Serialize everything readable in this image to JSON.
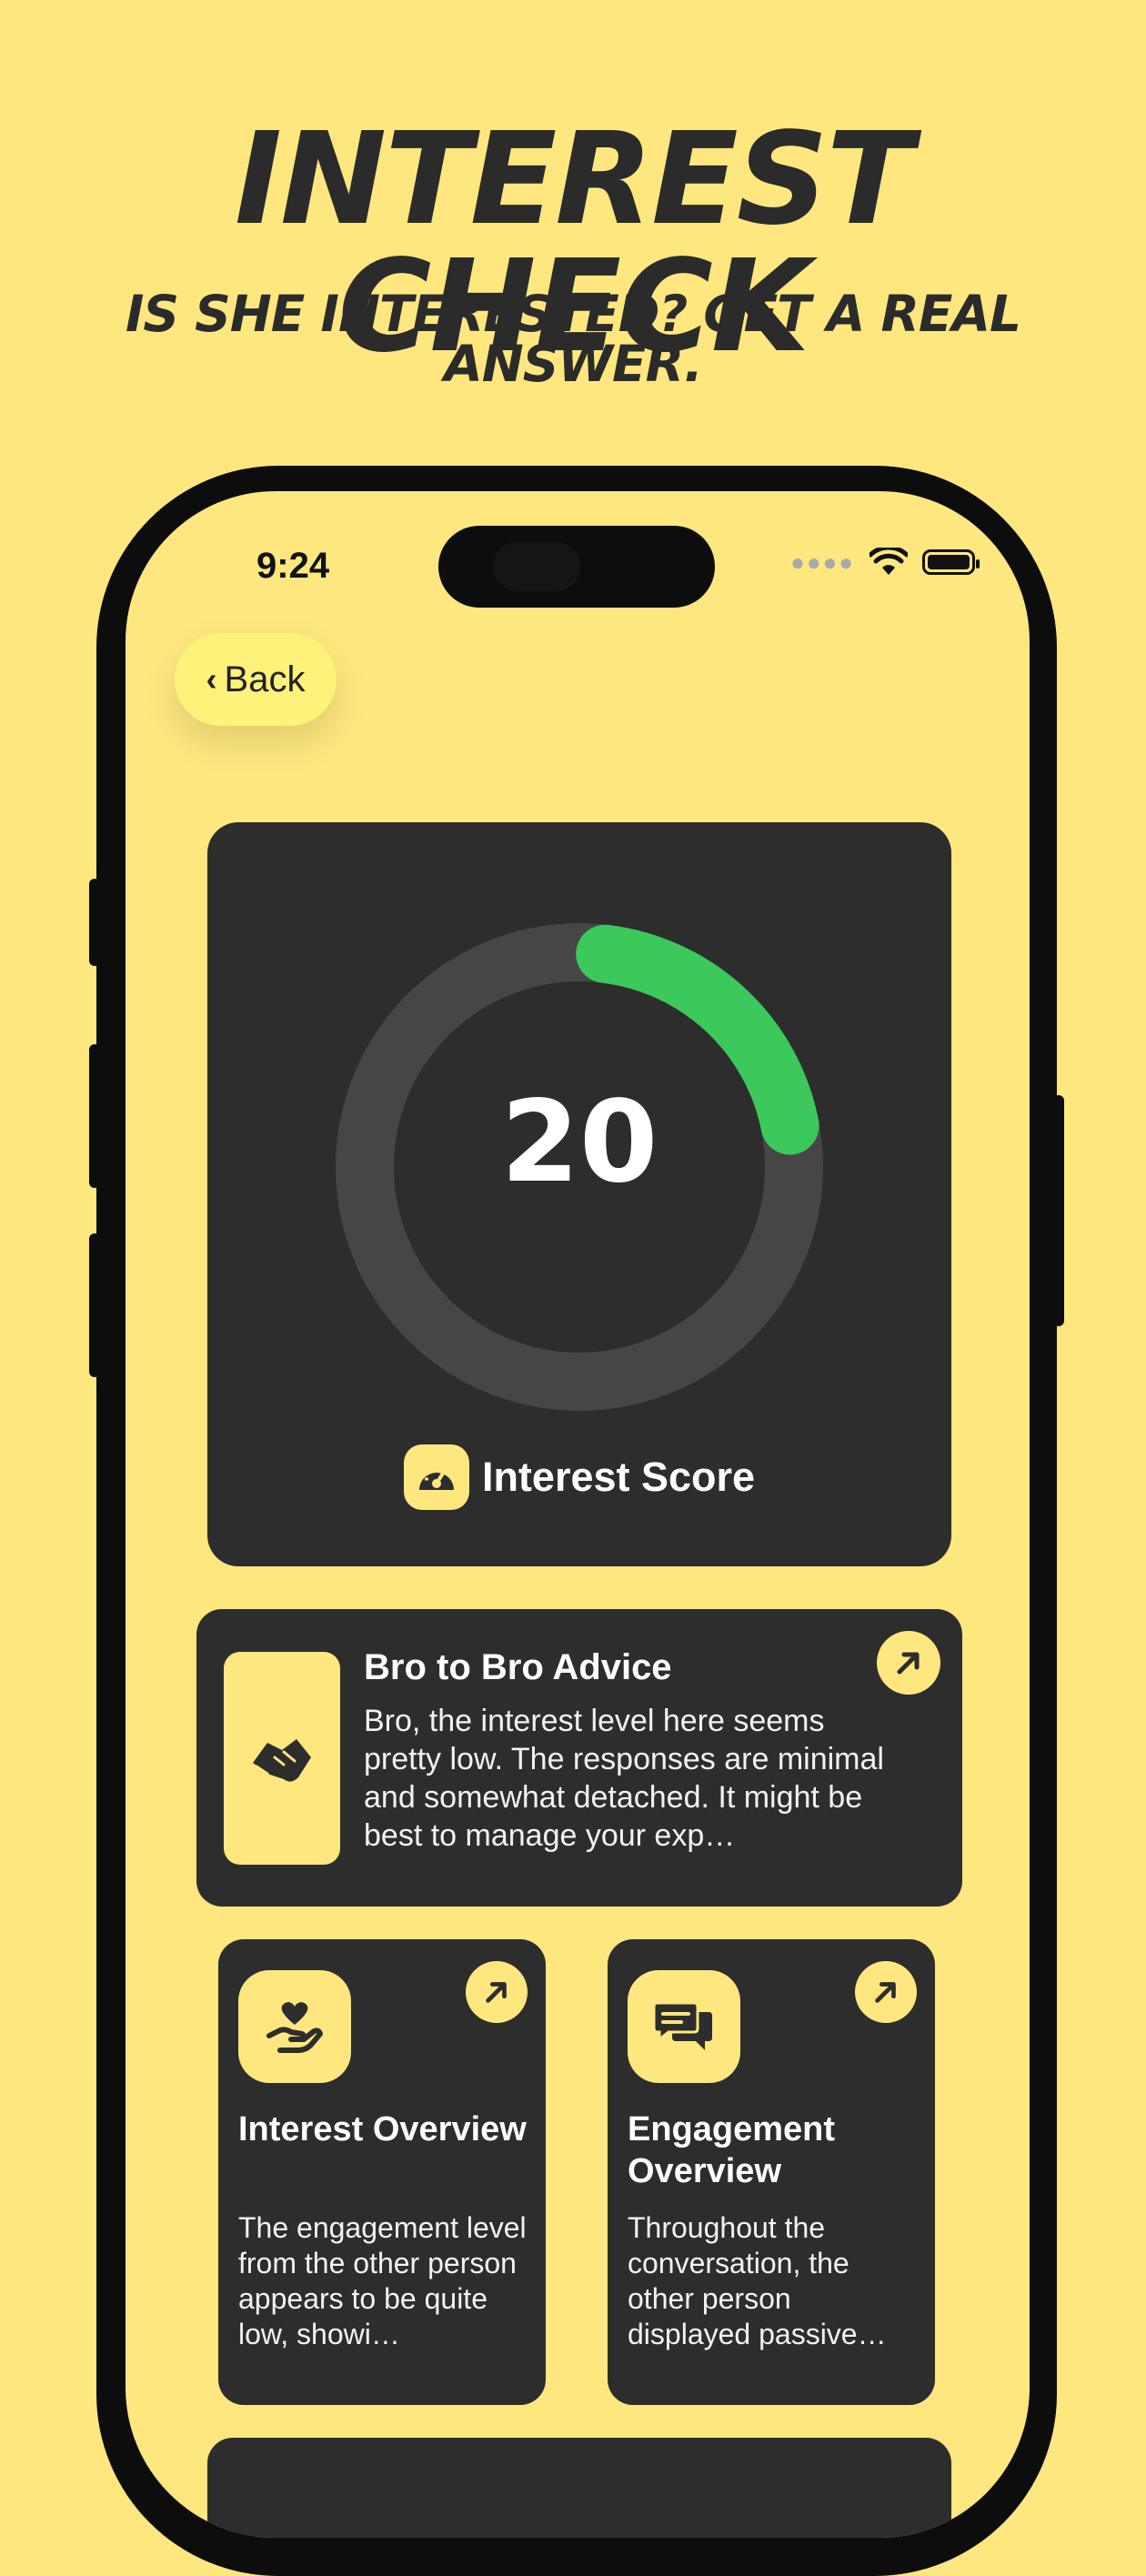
{
  "hero": {
    "title": "INTEREST CHECK",
    "subtitle": "IS SHE INTERESTED? GET A REAL ANSWER."
  },
  "status_bar": {
    "time": "9:24"
  },
  "nav": {
    "back_label": "Back"
  },
  "score": {
    "value": "20",
    "label": "Interest Score",
    "progress_fraction": 0.2,
    "accent_color": "#3CC85A",
    "track_color": "#464646"
  },
  "advice": {
    "title": "Bro to Bro Advice",
    "body": "Bro, the interest level here seems pretty low. The responses are minimal and somewhat detached. It might be best to manage your exp…",
    "icon": "handshake-icon"
  },
  "cards": [
    {
      "title": "Interest Overview",
      "body": "The engagement level from the other person appears to be quite low, showi…",
      "icon": "heart-hand-icon"
    },
    {
      "title": "Engagement Overview",
      "body": "Throughout the conversation, the other person displayed passive…",
      "icon": "chat-bubbles-icon"
    }
  ],
  "colors": {
    "background": "#FFE77F",
    "card": "#2D2D2D",
    "text_dark": "#2B2B2B"
  }
}
